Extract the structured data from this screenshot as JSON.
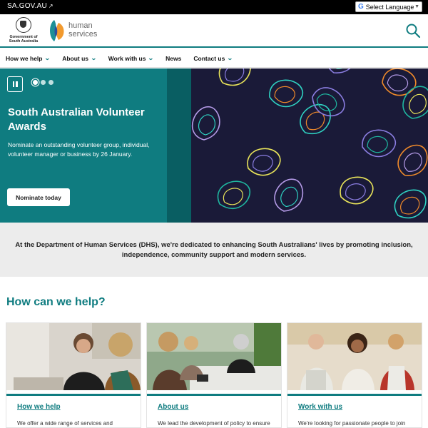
{
  "topbar": {
    "sagov_link": "SA.GOV.AU",
    "ext_icon": "↗",
    "language_select": "Select Language",
    "language_arrow": "▼",
    "google_g": "G"
  },
  "header": {
    "gov_logo_text": "Government of South Australia",
    "dhs_logo_text_1": "human",
    "dhs_logo_text_2": "services"
  },
  "nav": {
    "items": [
      {
        "label": "How we help",
        "has_menu": true
      },
      {
        "label": "About us",
        "has_menu": true
      },
      {
        "label": "Work with us",
        "has_menu": true
      },
      {
        "label": "News",
        "has_menu": false
      },
      {
        "label": "Contact us",
        "has_menu": true
      }
    ]
  },
  "hero": {
    "title": "South Australian Volunteer Awards",
    "description": "Nominate an outstanding volunteer group, individual, volunteer manager or business by 26 January.",
    "button": "Nominate today",
    "slide_count": 3,
    "active_slide": 1
  },
  "intro": {
    "text": "At the Department of Human Services (DHS), we're dedicated to enhancing South Australians' lives by promoting inclusion, independence, community support and modern services."
  },
  "help": {
    "heading": "How can we help?",
    "cards": [
      {
        "title": "How we help",
        "description": "We offer a wide range of services and resources designed to aid individuals,"
      },
      {
        "title": "About us",
        "description": "We lead the development of policy to ensure our programs and services are"
      },
      {
        "title": "Work with us",
        "description": "We're looking for passionate people to join us and help South Australia thrive. If you"
      }
    ]
  },
  "colors": {
    "brand_teal": "#0f7c80",
    "hero_dark": "#1a1a38",
    "intro_bg": "#ececec"
  }
}
